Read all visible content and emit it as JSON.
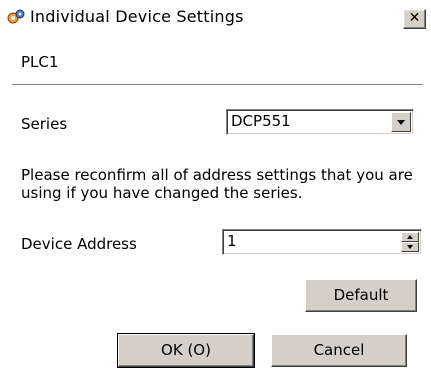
{
  "window": {
    "title": "Individual Device Settings",
    "close_label": "✕"
  },
  "device": {
    "name": "PLC1"
  },
  "series": {
    "label": "Series",
    "selected": "DCP551"
  },
  "note": "Please reconfirm all of address settings that you are using if you have changed the series.",
  "device_address": {
    "label": "Device Address",
    "value": "1"
  },
  "buttons": {
    "default_label": "Default",
    "ok_label": "OK (O)",
    "cancel_label": "Cancel"
  },
  "icons": {
    "app": "gears-icon",
    "close": "close-icon",
    "dropdown": "chevron-down-icon"
  },
  "colors": {
    "dialog_bg": "#ffffff",
    "button_face": "#d4d0c8"
  }
}
